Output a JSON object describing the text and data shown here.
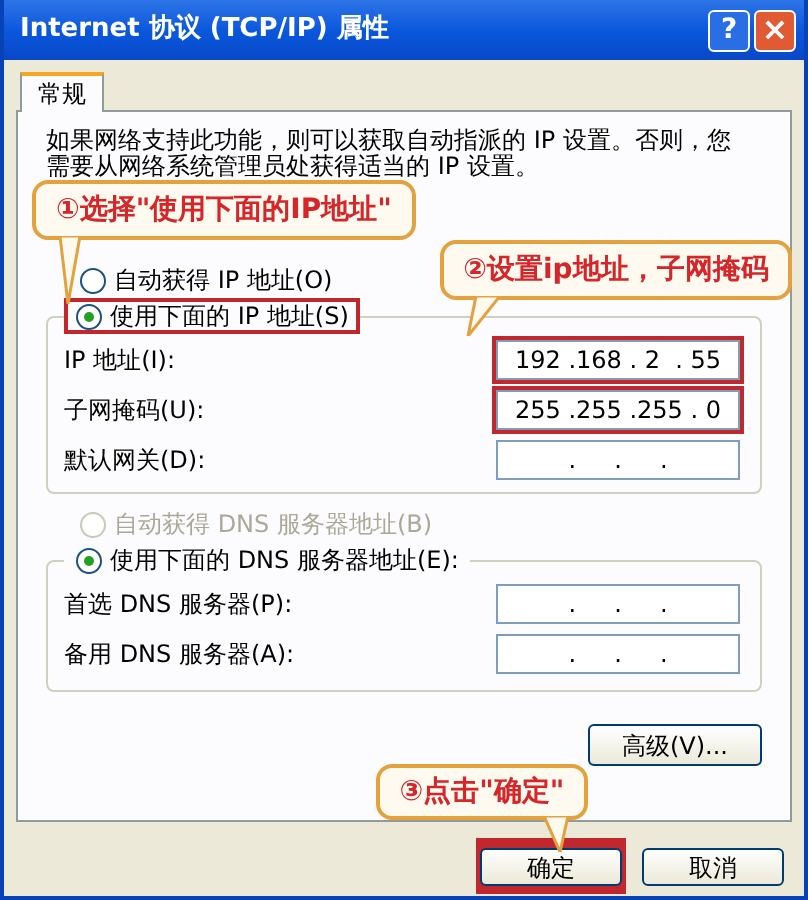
{
  "window": {
    "title": "Internet 协议 (TCP/IP) 属性",
    "help": "?",
    "close": "×"
  },
  "tabs": [
    {
      "label": "常规",
      "selected": true
    }
  ],
  "description": "如果网络支持此功能，则可以获取自动指派的 IP 设置。否则，您需要从网络系统管理员处获得适当的 IP 设置。",
  "ip_options": [
    {
      "label": "自动获得 IP 地址(O)",
      "selected": false,
      "disabled": false,
      "highlighted": false
    },
    {
      "label": "使用下面的 IP 地址(S)",
      "selected": true,
      "disabled": false,
      "highlighted": true
    }
  ],
  "ip_fields": [
    {
      "label": "IP 地址(I):",
      "value": "192 .168 . 2  . 55",
      "highlighted": true
    },
    {
      "label": "子网掩码(U):",
      "value": "255 .255 .255 . 0",
      "highlighted": true
    },
    {
      "label": "默认网关(D):",
      "value": ".     .     .",
      "highlighted": false
    }
  ],
  "dns_options": [
    {
      "label": "自动获得 DNS 服务器地址(B)",
      "selected": false,
      "disabled": true,
      "highlighted": false
    },
    {
      "label": "使用下面的 DNS 服务器地址(E):",
      "selected": true,
      "disabled": false,
      "highlighted": false
    }
  ],
  "dns_fields": [
    {
      "label": "首选 DNS 服务器(P):",
      "value": ".     .     .",
      "highlighted": false
    },
    {
      "label": "备用 DNS 服务器(A):",
      "value": ".     .     .",
      "highlighted": false
    }
  ],
  "advanced_button": "高级(V)...",
  "buttons": [
    {
      "label": "确定",
      "highlighted": true
    },
    {
      "label": "取消",
      "highlighted": false
    }
  ],
  "callouts": [
    "①选择\"使用下面的IP地址\"",
    "②设置ip地址，子网掩码",
    "③点击\"确定\""
  ]
}
